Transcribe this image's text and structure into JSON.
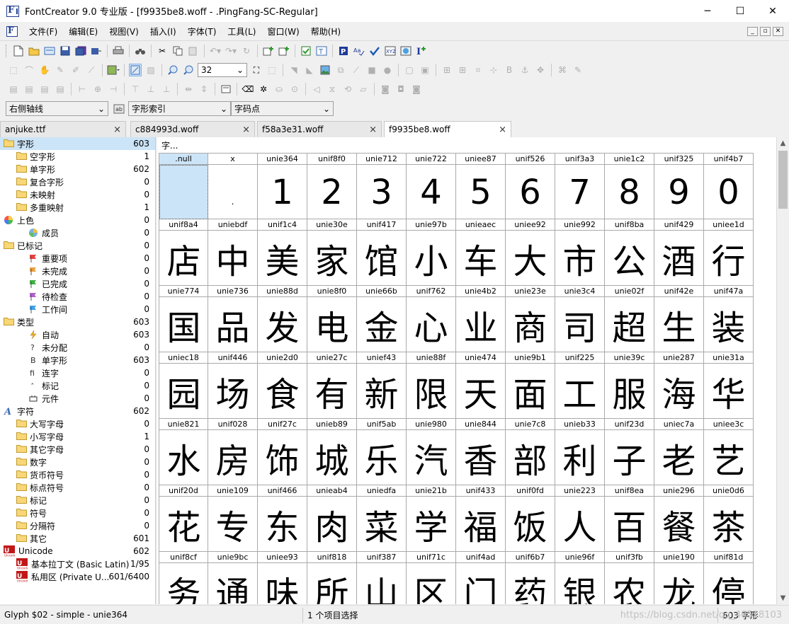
{
  "window": {
    "title": "FontCreator 9.0 专业版 - [f9935be8.woff - .PingFang-SC-Regular]",
    "minimize": "─",
    "maximize": "☐",
    "close": "✕"
  },
  "menubar": {
    "items": [
      "文件(F)",
      "编辑(E)",
      "视图(V)",
      "插入(I)",
      "字体(T)",
      "工具(L)",
      "窗口(W)",
      "帮助(H)"
    ],
    "mdi": [
      "_",
      "▫",
      "✕"
    ]
  },
  "toolbar": {
    "zoom_value": "32"
  },
  "combos": {
    "axis": "右侧轴线",
    "index": "字形索引",
    "codepoint": "字码点"
  },
  "tabs": [
    {
      "label": "anjuke.ttf",
      "close": "×"
    },
    {
      "label": "c884993d.woff",
      "close": "×"
    },
    {
      "label": "f58a3e31.woff",
      "close": "×"
    },
    {
      "label": "f9935be8.woff",
      "close": "×"
    }
  ],
  "tree": [
    {
      "label": "字形",
      "count": "603",
      "level": 0,
      "icon": "folder",
      "selected": true
    },
    {
      "label": "空字形",
      "count": "1",
      "level": 1,
      "icon": "folder"
    },
    {
      "label": "单字形",
      "count": "602",
      "level": 1,
      "icon": "folder"
    },
    {
      "label": "复合字形",
      "count": "0",
      "level": 1,
      "icon": "folder"
    },
    {
      "label": "未映射",
      "count": "0",
      "level": 1,
      "icon": "folder"
    },
    {
      "label": "多重映射",
      "count": "1",
      "level": 1,
      "icon": "folder"
    },
    {
      "label": "上色",
      "count": "0",
      "level": 0,
      "icon": "color-wheel"
    },
    {
      "label": "成员",
      "count": "0",
      "level": 2,
      "icon": "color-ball"
    },
    {
      "label": "已标记",
      "count": "0",
      "level": 0,
      "icon": "folder"
    },
    {
      "label": "重要项",
      "count": "0",
      "level": 2,
      "icon": "flag-red"
    },
    {
      "label": "未完成",
      "count": "0",
      "level": 2,
      "icon": "flag-orange"
    },
    {
      "label": "已完成",
      "count": "0",
      "level": 2,
      "icon": "flag-green"
    },
    {
      "label": "待检查",
      "count": "0",
      "level": 2,
      "icon": "flag-purple"
    },
    {
      "label": "工作间",
      "count": "0",
      "level": 2,
      "icon": "flag-blue"
    },
    {
      "label": "类型",
      "count": "603",
      "level": 0,
      "icon": "folder"
    },
    {
      "label": "自动",
      "count": "603",
      "level": 2,
      "icon": "bolt"
    },
    {
      "label": "未分配",
      "count": "0",
      "level": 2,
      "icon": "question"
    },
    {
      "label": "单字形",
      "count": "603",
      "level": 2,
      "icon": "letter-b"
    },
    {
      "label": "连字",
      "count": "0",
      "level": 2,
      "icon": "ligature"
    },
    {
      "label": "标记",
      "count": "0",
      "level": 2,
      "icon": "caret"
    },
    {
      "label": "元件",
      "count": "0",
      "level": 2,
      "icon": "component"
    },
    {
      "label": "字符",
      "count": "602",
      "level": 0,
      "icon": "letter-a"
    },
    {
      "label": "大写字母",
      "count": "0",
      "level": 1,
      "icon": "folder"
    },
    {
      "label": "小写字母",
      "count": "1",
      "level": 1,
      "icon": "folder"
    },
    {
      "label": "其它字母",
      "count": "0",
      "level": 1,
      "icon": "folder"
    },
    {
      "label": "数字",
      "count": "0",
      "level": 1,
      "icon": "folder"
    },
    {
      "label": "货币符号",
      "count": "0",
      "level": 1,
      "icon": "folder"
    },
    {
      "label": "标点符号",
      "count": "0",
      "level": 1,
      "icon": "folder"
    },
    {
      "label": "标记",
      "count": "0",
      "level": 1,
      "icon": "folder"
    },
    {
      "label": "符号",
      "count": "0",
      "level": 1,
      "icon": "folder"
    },
    {
      "label": "分隔符",
      "count": "0",
      "level": 1,
      "icon": "folder"
    },
    {
      "label": "其它",
      "count": "601",
      "level": 1,
      "icon": "folder"
    },
    {
      "label": "Unicode",
      "count": "602",
      "level": 0,
      "icon": "unicode"
    },
    {
      "label": "基本拉丁文 (Basic Latin)",
      "count": "1/95",
      "level": 1,
      "icon": "unicode"
    },
    {
      "label": "私用区 (Private U...",
      "count": "601/6400",
      "level": 1,
      "icon": "unicode"
    }
  ],
  "content": {
    "header": "字..."
  },
  "glyph_grid": [
    [
      {
        "name": ".null",
        "glyph": "",
        "selected": true
      },
      {
        "name": "x",
        "glyph": "."
      },
      {
        "name": "unie364",
        "glyph": "1"
      },
      {
        "name": "unif8f0",
        "glyph": "2"
      },
      {
        "name": "unie712",
        "glyph": "3"
      },
      {
        "name": "unie722",
        "glyph": "4"
      },
      {
        "name": "uniee87",
        "glyph": "5"
      },
      {
        "name": "unif526",
        "glyph": "6"
      },
      {
        "name": "unif3a3",
        "glyph": "7"
      },
      {
        "name": "unie1c2",
        "glyph": "8"
      },
      {
        "name": "unif325",
        "glyph": "9"
      },
      {
        "name": "unif4b7",
        "glyph": "0"
      }
    ],
    [
      {
        "name": "unif8a4",
        "glyph": "店"
      },
      {
        "name": "uniebdf",
        "glyph": "中"
      },
      {
        "name": "unif1c4",
        "glyph": "美"
      },
      {
        "name": "unie30e",
        "glyph": "家"
      },
      {
        "name": "unif417",
        "glyph": "馆"
      },
      {
        "name": "unie97b",
        "glyph": "小"
      },
      {
        "name": "unieaec",
        "glyph": "车"
      },
      {
        "name": "uniee92",
        "glyph": "大"
      },
      {
        "name": "unie992",
        "glyph": "市"
      },
      {
        "name": "unif8ba",
        "glyph": "公"
      },
      {
        "name": "unif429",
        "glyph": "酒"
      },
      {
        "name": "uniee1d",
        "glyph": "行"
      }
    ],
    [
      {
        "name": "unie774",
        "glyph": "国"
      },
      {
        "name": "unie736",
        "glyph": "品"
      },
      {
        "name": "unie88d",
        "glyph": "发"
      },
      {
        "name": "unie8f0",
        "glyph": "电"
      },
      {
        "name": "unie66b",
        "glyph": "金"
      },
      {
        "name": "unif762",
        "glyph": "心"
      },
      {
        "name": "unie4b2",
        "glyph": "业"
      },
      {
        "name": "unie23e",
        "glyph": "商"
      },
      {
        "name": "unie3c4",
        "glyph": "司"
      },
      {
        "name": "unie02f",
        "glyph": "超"
      },
      {
        "name": "unif42e",
        "glyph": "生"
      },
      {
        "name": "unif47a",
        "glyph": "装"
      }
    ],
    [
      {
        "name": "uniec18",
        "glyph": "园"
      },
      {
        "name": "unif446",
        "glyph": "场"
      },
      {
        "name": "unie2d0",
        "glyph": "食"
      },
      {
        "name": "unie27c",
        "glyph": "有"
      },
      {
        "name": "unief43",
        "glyph": "新"
      },
      {
        "name": "unie88f",
        "glyph": "限"
      },
      {
        "name": "unie474",
        "glyph": "天"
      },
      {
        "name": "unie9b1",
        "glyph": "面"
      },
      {
        "name": "unif225",
        "glyph": "工"
      },
      {
        "name": "unie39c",
        "glyph": "服"
      },
      {
        "name": "unie287",
        "glyph": "海"
      },
      {
        "name": "unie31a",
        "glyph": "华"
      }
    ],
    [
      {
        "name": "unie821",
        "glyph": "水"
      },
      {
        "name": "unif028",
        "glyph": "房"
      },
      {
        "name": "unif27c",
        "glyph": "饰"
      },
      {
        "name": "unieb89",
        "glyph": "城"
      },
      {
        "name": "unif5ab",
        "glyph": "乐"
      },
      {
        "name": "unie980",
        "glyph": "汽"
      },
      {
        "name": "unie844",
        "glyph": "香"
      },
      {
        "name": "unie7c8",
        "glyph": "部"
      },
      {
        "name": "unieb33",
        "glyph": "利"
      },
      {
        "name": "unif23d",
        "glyph": "子"
      },
      {
        "name": "uniec7a",
        "glyph": "老"
      },
      {
        "name": "uniee3c",
        "glyph": "艺"
      }
    ],
    [
      {
        "name": "unif20d",
        "glyph": "花"
      },
      {
        "name": "unie109",
        "glyph": "专"
      },
      {
        "name": "unif466",
        "glyph": "东"
      },
      {
        "name": "unieab4",
        "glyph": "肉"
      },
      {
        "name": "uniedfa",
        "glyph": "菜"
      },
      {
        "name": "unie21b",
        "glyph": "学"
      },
      {
        "name": "unif433",
        "glyph": "福"
      },
      {
        "name": "unif0fd",
        "glyph": "饭"
      },
      {
        "name": "unie223",
        "glyph": "人"
      },
      {
        "name": "unif8ea",
        "glyph": "百"
      },
      {
        "name": "unie296",
        "glyph": "餐"
      },
      {
        "name": "unie0d6",
        "glyph": "茶"
      }
    ],
    [
      {
        "name": "unif8cf",
        "glyph": "务"
      },
      {
        "name": "unie9bc",
        "glyph": "通"
      },
      {
        "name": "uniee93",
        "glyph": "味"
      },
      {
        "name": "unif818",
        "glyph": "所"
      },
      {
        "name": "unif387",
        "glyph": "山"
      },
      {
        "name": "unif71c",
        "glyph": "区"
      },
      {
        "name": "unif4ad",
        "glyph": "门"
      },
      {
        "name": "unif6b7",
        "glyph": "药"
      },
      {
        "name": "unie96f",
        "glyph": "银"
      },
      {
        "name": "unif3fb",
        "glyph": "农"
      },
      {
        "name": "unie190",
        "glyph": "龙"
      },
      {
        "name": "unif81d",
        "glyph": "停"
      }
    ]
  ],
  "status": {
    "glyph_info": "Glyph $02 - simple - unie364",
    "selection": "1 个项目选择",
    "count": "603 字形",
    "watermark": "https://blog.csdn.net/qq_40518103"
  }
}
